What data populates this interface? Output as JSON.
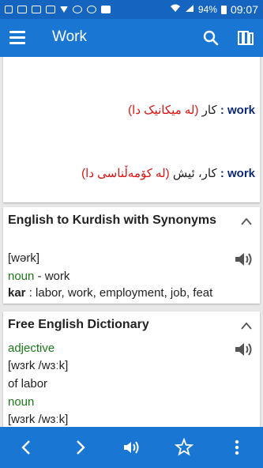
{
  "status": {
    "time": "09:07",
    "battery": "94%"
  },
  "appbar": {
    "title": "Work"
  },
  "card1": {
    "lines": [
      {
        "word": "work",
        "colon": " : ",
        "paren": "(له میکانیک دا)",
        "rest": " کار"
      },
      {
        "word": "work",
        "colon": " : ",
        "paren": "(له کۆمەڵناسی دا)",
        "rest": " کار، ئیش"
      }
    ]
  },
  "card2": {
    "title": "English to Kurdish with Synonyms",
    "pron": "[wərk]",
    "pos": "noun",
    "pos_rest": " - work",
    "kar_label": "kar",
    "kar_rest": " : labor, work, employment, job, feat"
  },
  "card3": {
    "title": "Free English Dictionary",
    "pos1": "adjective",
    "pron1": "[wɜrk /wɜːk]",
    "def1": "of labor",
    "pos2": "noun",
    "pron2": "[wɜrk /wɜːk]"
  },
  "colors": {
    "primary": "#1976d2",
    "status": "#1565c0",
    "accent_red": "#dd1111",
    "green": "#1b7a1b",
    "navy": "#0d2a7a"
  }
}
